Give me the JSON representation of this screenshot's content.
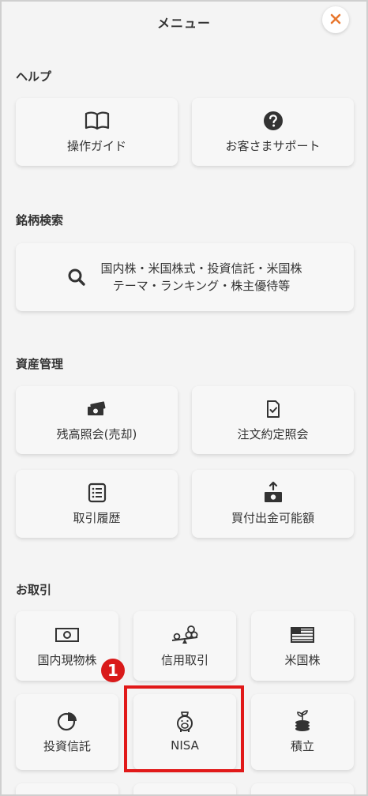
{
  "header": {
    "title": "メニュー"
  },
  "sections": {
    "help": {
      "title": "ヘルプ",
      "items": [
        {
          "label": "操作ガイド",
          "icon": "book-icon"
        },
        {
          "label": "お客さまサポート",
          "icon": "question-icon"
        }
      ]
    },
    "search": {
      "title": "銘柄検索",
      "line1": "国内株・米国株式・投資信託・米国株",
      "line2": "テーマ・ランキング・株主優待等",
      "icon": "search-icon"
    },
    "assets": {
      "title": "資産管理",
      "items": [
        {
          "label": "残高照会(売却)",
          "icon": "money-stack-icon"
        },
        {
          "label": "注文約定照会",
          "icon": "document-check-icon"
        },
        {
          "label": "取引履歴",
          "icon": "list-icon"
        },
        {
          "label": "買付出金可能額",
          "icon": "money-upload-icon"
        }
      ]
    },
    "trade": {
      "title": "お取引",
      "items": [
        {
          "label": "国内現物株",
          "icon": "banknote-icon"
        },
        {
          "label": "信用取引",
          "icon": "coins-scale-icon"
        },
        {
          "label": "米国株",
          "icon": "us-flag-icon"
        },
        {
          "label": "投資信託",
          "icon": "pie-chart-icon"
        },
        {
          "label": "NISA",
          "icon": "piggy-bank-icon"
        },
        {
          "label": "積立",
          "icon": "coin-plant-icon"
        }
      ]
    }
  },
  "annotation": {
    "badge": "1"
  },
  "colors": {
    "accent": "#e8772e",
    "highlight": "#e11919"
  }
}
